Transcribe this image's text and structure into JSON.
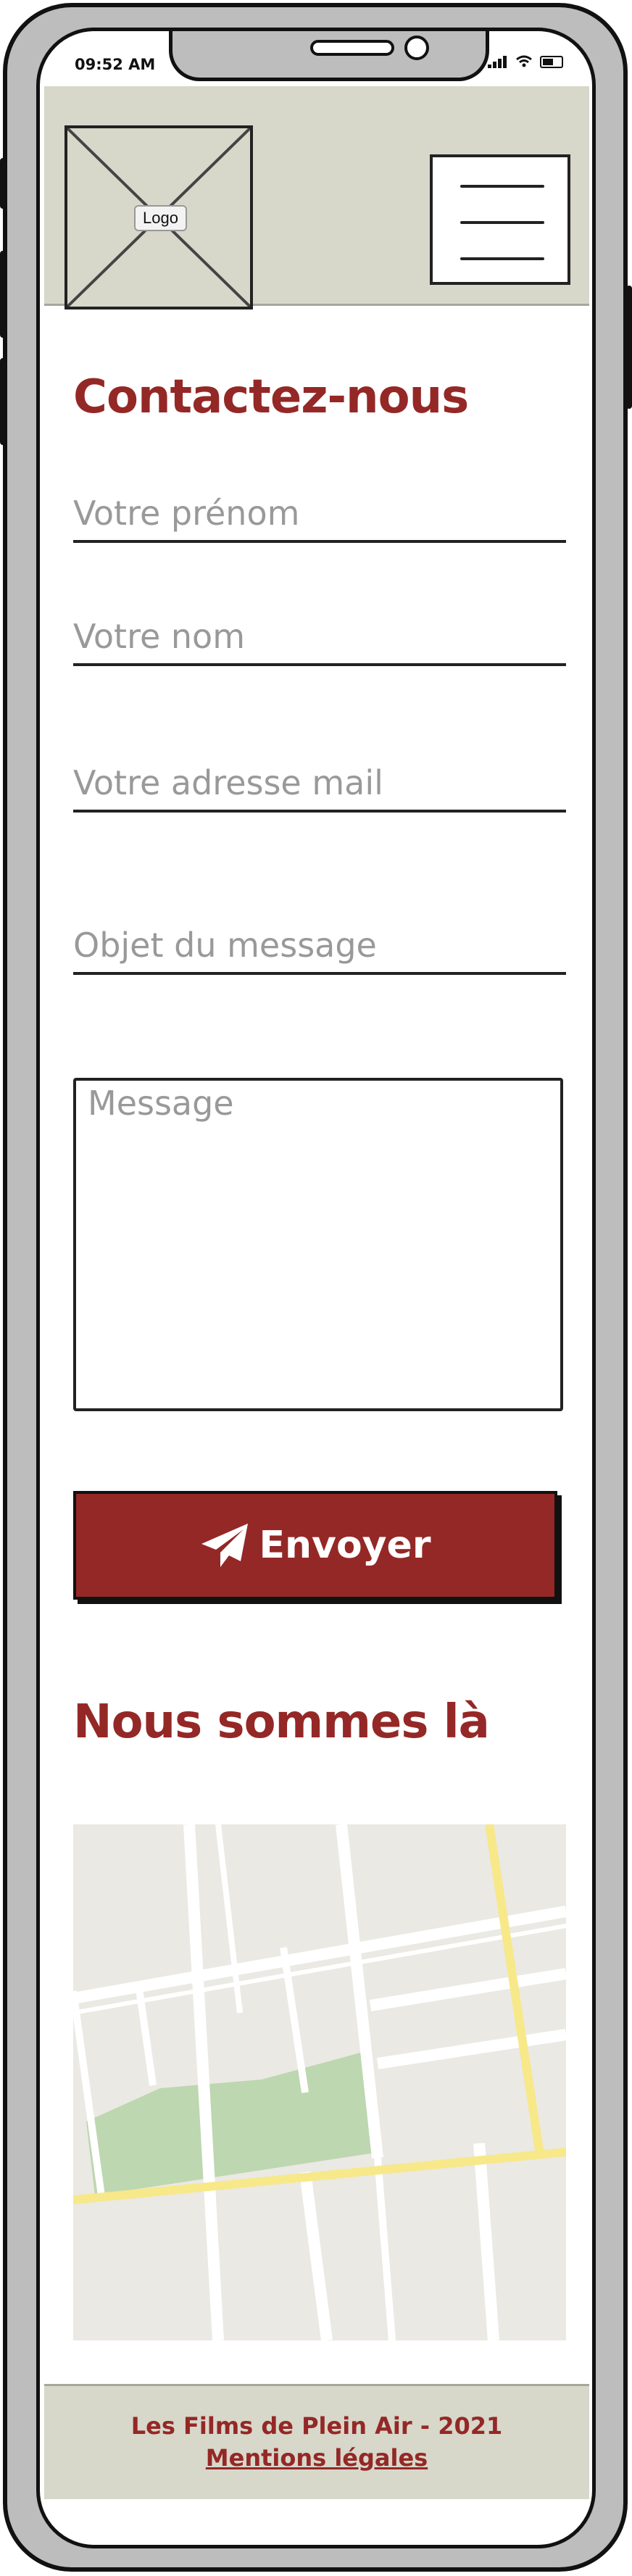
{
  "status_bar": {
    "time": "09:52 AM"
  },
  "header": {
    "logo_label": "Logo",
    "menu_icon": "hamburger-menu-icon"
  },
  "contact": {
    "title": "Contactez-nous",
    "first_name_placeholder": "Votre prénom",
    "last_name_placeholder": "Votre nom",
    "email_placeholder": "Votre adresse mail",
    "subject_placeholder": "Objet du message",
    "message_placeholder": "Message",
    "send_label": "Envoyer",
    "send_icon": "paper-plane-icon"
  },
  "location": {
    "title": "Nous sommes là"
  },
  "footer": {
    "copyright": "Les Films de Plein Air - 2021",
    "legal_link": "Mentions légales"
  },
  "colors": {
    "accent": "#942826",
    "header_bg": "#d7d7ca",
    "placeholder": "#999999",
    "map_road_major": "#f7e88a",
    "map_park": "#bdd7b0"
  }
}
